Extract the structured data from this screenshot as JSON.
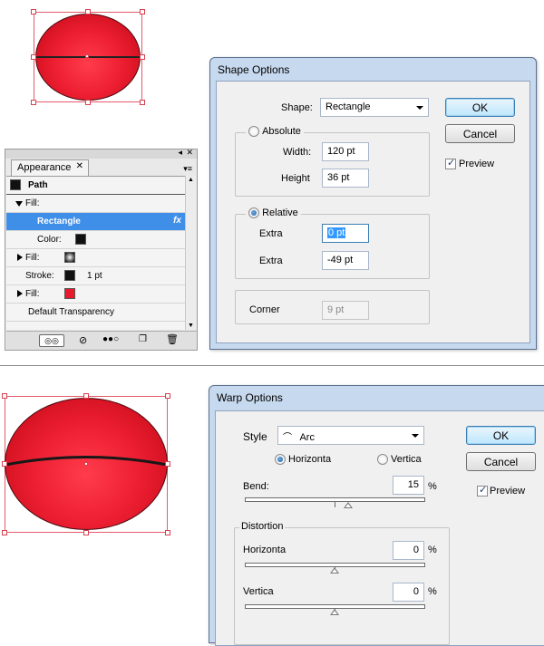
{
  "shape_options": {
    "title": "Shape Options",
    "shape_label": "Shape:",
    "shape_value": "Rectangle",
    "absolute_label": "Absolute",
    "width_label": "Width:",
    "width_value": "120 pt",
    "height_label": "Height",
    "height_value": "36 pt",
    "relative_label": "Relative",
    "extra1_label": "Extra",
    "extra1_value": "0 pt",
    "extra2_label": "Extra",
    "extra2_value": "-49 pt",
    "corner_label": "Corner",
    "corner_value": "9 pt",
    "ok_label": "OK",
    "cancel_label": "Cancel",
    "preview_label": "Preview",
    "preview_checked": true
  },
  "appearance_panel": {
    "tab_label": "Appearance",
    "rows": {
      "path_label": "Path",
      "fill_label": "Fill:",
      "rectangle_label": "Rectangle",
      "fx_label": "fx",
      "color_label": "Color:",
      "fill2_label": "Fill:",
      "stroke_label": "Stroke:",
      "stroke_value": "1 pt",
      "fill3_label": "Fill:",
      "transparency_label": "Default Transparency"
    }
  },
  "warp_options": {
    "title": "Warp Options",
    "style_label": "Style",
    "style_value": "Arc",
    "horizontal_label": "Horizonta",
    "vertical_label": "Vertica",
    "bend_label": "Bend:",
    "bend_value": "15",
    "distortion_label": "Distortion",
    "dist_horizontal_label": "Horizonta",
    "dist_horizontal_value": "0",
    "dist_vertical_label": "Vertica",
    "dist_vertical_value": "0",
    "percent": "%",
    "ok_label": "OK",
    "cancel_label": "Cancel",
    "preview_label": "Preview",
    "preview_checked": true,
    "bend_fraction": 0.575
  },
  "colors": {
    "fill_red": "#e8192c",
    "selection": "#e45a6a",
    "panel_selected": "#3f8ee8"
  }
}
